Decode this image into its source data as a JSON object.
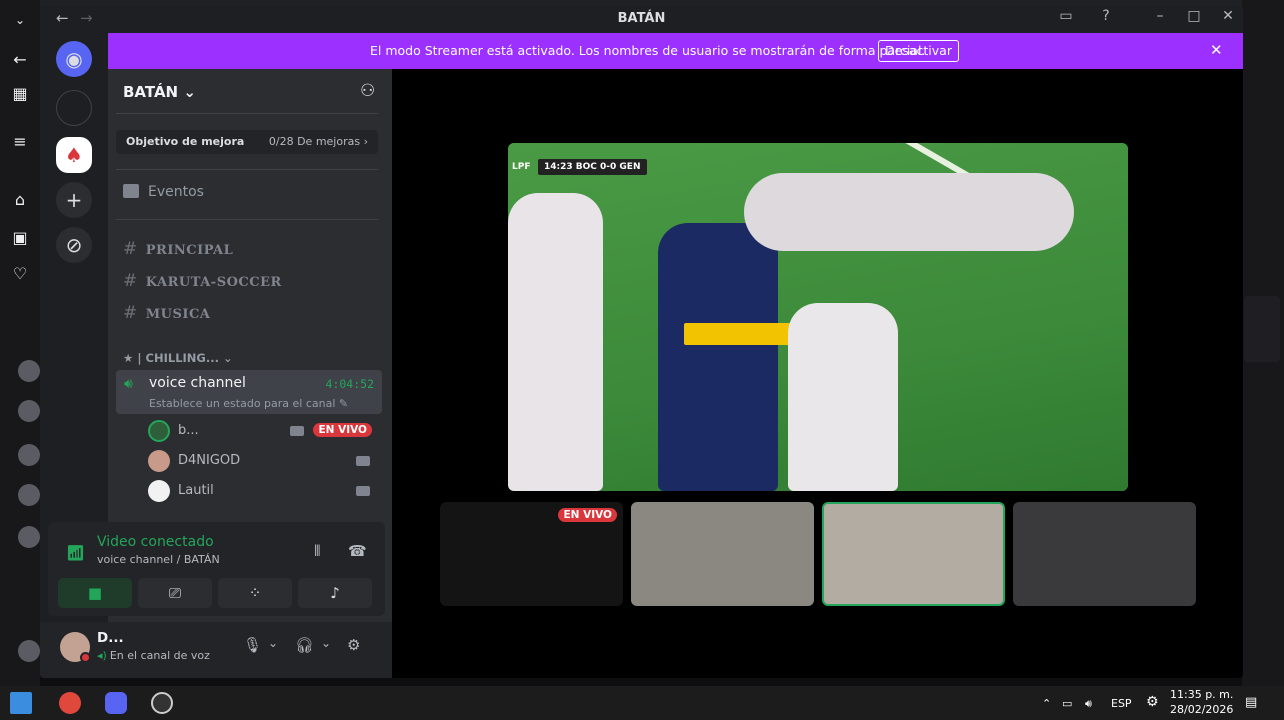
{
  "window": {
    "title": "BATÁN"
  },
  "banner": {
    "message": "El modo Streamer está activado. Los nombres de usuario se mostrarán de forma parcial.",
    "button": "Desactivar"
  },
  "server": {
    "name": "BATÁN",
    "boost_goal": "Objetivo de mejora",
    "boost_count": "0/28 De mejoras",
    "events": "Eventos",
    "channels": [
      "PRINCIPAL",
      "KARUTA-SOCCER",
      "MUSICA"
    ],
    "category": "★ | CHILLING..."
  },
  "voice_channel": {
    "name": "voice channel",
    "time": "4:04:52",
    "status": "Establece un estado para el canal",
    "users": [
      {
        "name": "b...",
        "live": "EN VIVO"
      },
      {
        "name": "D4NIGOD"
      },
      {
        "name": "Lautil"
      }
    ]
  },
  "rtc": {
    "title": "Video conectado",
    "subtitle": "voice channel / BATÁN"
  },
  "user": {
    "name": "D...",
    "status": "En el canal de voz"
  },
  "stage": {
    "scoreboard": "14:23  BOC 0-0 GEN",
    "league": "LPF",
    "tile_live": "EN VIVO"
  },
  "taskbar": {
    "lang": "ESP",
    "time": "11:35 p. m.",
    "date": "28/02/2026"
  },
  "colors": {
    "accent": "#9b30ff",
    "green": "#23a55a",
    "live": "#da373c"
  }
}
